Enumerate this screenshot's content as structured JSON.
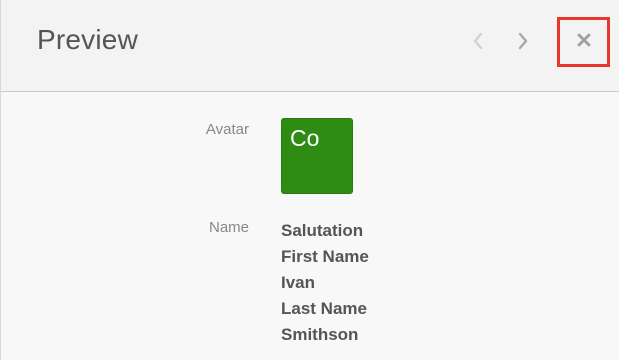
{
  "header": {
    "title": "Preview",
    "prev_icon": "chevron-left-icon",
    "next_icon": "chevron-right-icon",
    "close_icon": "close-icon",
    "highlight_color": "#e8372a"
  },
  "fields": {
    "avatar": {
      "label": "Avatar",
      "initials": "Co",
      "color": "#2e8b14"
    },
    "name": {
      "label": "Name",
      "lines": [
        "Salutation",
        "First Name",
        "Ivan",
        "Last Name",
        "Smithson"
      ]
    }
  }
}
